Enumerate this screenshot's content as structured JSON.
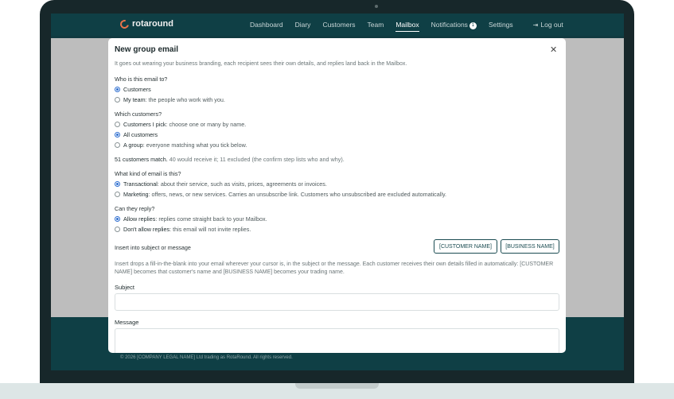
{
  "app": {
    "logo_text": "rotaround",
    "nav": [
      {
        "label": "Dashboard"
      },
      {
        "label": "Diary"
      },
      {
        "label": "Customers"
      },
      {
        "label": "Team"
      },
      {
        "label": "Mailbox"
      },
      {
        "label": "Notifications"
      },
      {
        "label": "Settings"
      }
    ],
    "notifications_count": "1",
    "logout_label": "Log out",
    "footer": "© 2026 [COMPANY LEGAL NAME] Ltd trading as RotaRound. All rights reserved."
  },
  "modal": {
    "title": "New group email",
    "close_symbol": "✕",
    "subtitle": "It goes out wearing your business branding, each recipient sees their own details, and replies land back in the Mailbox.",
    "recipients": {
      "question": "Who is this email to?",
      "options": [
        {
          "label": "Customers",
          "desc": "",
          "selected": true
        },
        {
          "label": "My team",
          "desc": ": the people who work with you.",
          "selected": false
        }
      ]
    },
    "which_customers": {
      "question": "Which customers?",
      "options": [
        {
          "label": "Customers I pick",
          "desc": ": choose one or many by name.",
          "selected": false
        },
        {
          "label": "All customers",
          "desc": "",
          "selected": true
        },
        {
          "label": "A group",
          "desc": ": everyone matching what you tick below.",
          "selected": false
        }
      ]
    },
    "match": {
      "strong": "51 customers match.",
      "rest": " 40 would receive it; 11 excluded (the confirm step lists who and why)."
    },
    "kind": {
      "question": "What kind of email is this?",
      "options": [
        {
          "label": "Transactional",
          "desc": ": about their service, such as visits, prices, agreements or invoices.",
          "selected": true
        },
        {
          "label": "Marketing",
          "desc": ": offers, news, or new services. Carries an unsubscribe link. Customers who unsubscribed are excluded automatically.",
          "selected": false
        }
      ]
    },
    "reply": {
      "question": "Can they reply?",
      "options": [
        {
          "label": "Allow replies",
          "desc": ": replies come straight back to your Mailbox.",
          "selected": true
        },
        {
          "label": "Don't allow replies",
          "desc": ": this email will not invite replies.",
          "selected": false
        }
      ]
    },
    "insert": {
      "label": "Insert into subject or message",
      "tokens": [
        "[CUSTOMER NAME]",
        "[BUSINESS NAME]"
      ],
      "help": "Insert drops a fill-in-the-blank into your email wherever your cursor is, in the subject or the message. Each customer receives their own details filled in automatically: [CUSTOMER NAME] becomes that customer's name and [BUSINESS NAME] becomes your trading name."
    },
    "subject": {
      "label": "Subject",
      "value": "",
      "placeholder": ""
    },
    "message": {
      "label": "Message",
      "value": "",
      "placeholder": ""
    }
  },
  "colors": {
    "nav_bg": "#0f3f45",
    "accent_radio": "#2f6fd0",
    "logo_accent": "#e8734a",
    "overlay": "#bdbdbd"
  }
}
